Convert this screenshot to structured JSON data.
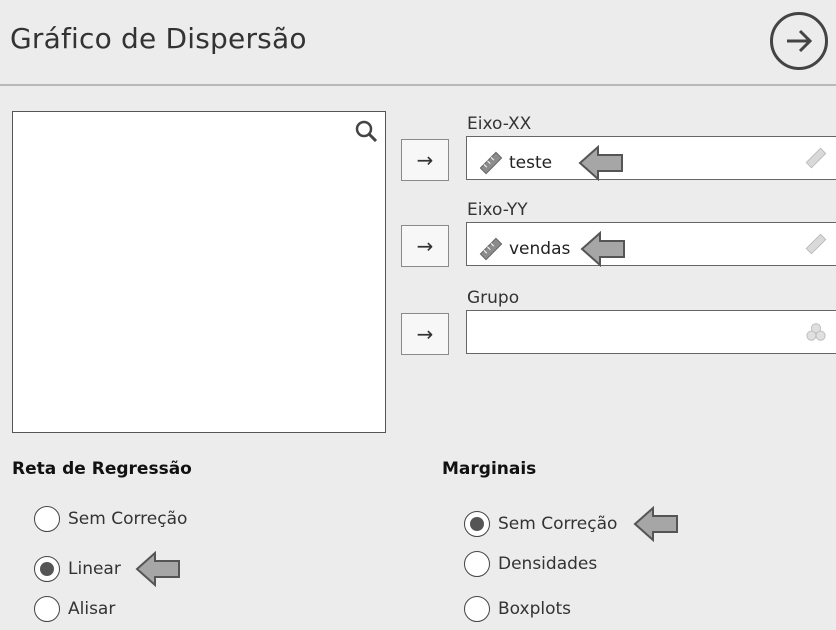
{
  "header": {
    "title": "Gráfico de Dispersão",
    "run_icon": "arrow-right-circle-icon"
  },
  "variable_list": {
    "search_icon": "search-icon",
    "items": []
  },
  "fields": [
    {
      "label": "Eixo-XX",
      "value": "teste",
      "assign_symbol": "→"
    },
    {
      "label": "Eixo-YY",
      "value": "vendas",
      "assign_symbol": "→"
    },
    {
      "label": "Grupo",
      "value": "",
      "assign_symbol": "→"
    }
  ],
  "regression": {
    "title": "Reta de Regressão",
    "options": [
      {
        "label": "Sem Correção",
        "selected": false
      },
      {
        "label": "Linear",
        "selected": true
      },
      {
        "label": "Alisar",
        "selected": false
      }
    ]
  },
  "marginals": {
    "title": "Marginais",
    "options": [
      {
        "label": "Sem Correção",
        "selected": true
      },
      {
        "label": "Densidades",
        "selected": false
      },
      {
        "label": "Boxplots",
        "selected": false
      }
    ]
  },
  "colors": {
    "background": "#ececec",
    "pointer_arrow": "#a6a6a6",
    "radio_fill": "#555555"
  }
}
